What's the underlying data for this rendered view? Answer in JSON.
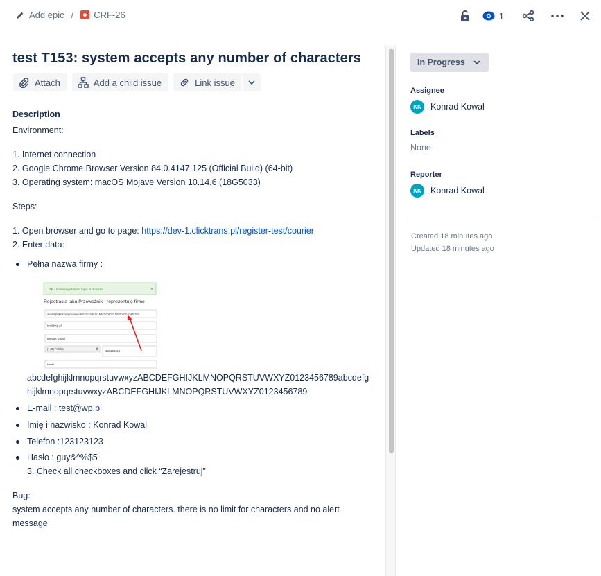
{
  "breadcrumb": {
    "add_epic": "Add epic",
    "separator": "/",
    "issue_key": "CRF-26"
  },
  "top_actions": {
    "watch_count": "1"
  },
  "issue": {
    "title": "test T153: system accepts any number of characters"
  },
  "toolbar": {
    "attach": "Attach",
    "add_child": "Add a child issue",
    "link_issue": "Link issue"
  },
  "description": {
    "heading": "Description",
    "environment": "Environment:",
    "env_items": [
      "1. Internet connection",
      "2. Google Chrome Browser Version 84.0.4147.125 (Official Build) (64-bit)",
      "3. Operating system: macOS Mojave Version 10.14.6 (18G5033)"
    ],
    "steps": "Steps:",
    "step1_text": "1. Open browser and go to page: ",
    "step1_link": "https://dev-1.clicktrans.pl/register-test/courier",
    "step2": "2. Enter data:",
    "bullet_company": "Pełna nazwa firmy :",
    "thumbnail": {
      "banner": "OK - some registration logic is mocked",
      "close": "×",
      "form_title": "Rejestracja jako Przewoźnik - reprezentuję firmę",
      "field1": "abcdefghijklmnopqrstuvwxyzABCDEFGHIJKLMNOPQRSTUVWXYZ0123456789",
      "field2": "test@wp.pl",
      "field3": "Konrad Kowal",
      "field4_select": "(+48) Polska",
      "field4_phone": "123123123",
      "field5": "******"
    },
    "long_value": "abcdefghijklmnopqrstuvwxyzABCDEFGHIJKLMNOPQRSTUVWXYZ0123456789abcdefghijklmnopqrstuvwxyzABCDEFGHIJKLMNOPQRSTUVWXYZ0123456789",
    "bullet_email": "E-mail : test@wp.pl",
    "bullet_name": "Imię i nazwisko : Konrad Kowal",
    "bullet_phone": "Telefon :123123123",
    "bullet_password": "Hasło : guy&^%$5",
    "step3": "3. Check all checkboxes and click “Zarejestruj”",
    "bug_label": "Bug:",
    "bug_text": "system accepts any number of characters. there is no limit for characters and no alert message"
  },
  "sidebar": {
    "status": "In Progress",
    "assignee_label": "Assignee",
    "assignee_initials": "KK",
    "assignee_name": "Konrad Kowal",
    "labels_label": "Labels",
    "labels_value": "None",
    "reporter_label": "Reporter",
    "reporter_initials": "KK",
    "reporter_name": "Konrad Kowal",
    "created": "Created 18 minutes ago",
    "updated": "Updated 18 minutes ago"
  },
  "colors": {
    "link": "#0052cc",
    "text": "#172b4d",
    "issue_type": "#e5493a",
    "avatar": "#00a3bf",
    "status_bg": "#dfe1e6"
  }
}
